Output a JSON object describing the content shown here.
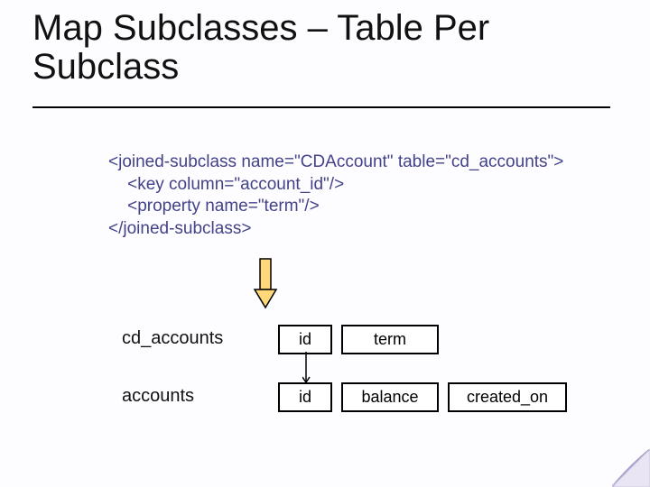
{
  "title": "Map Subclasses – Table Per Subclass",
  "code": {
    "l1": "<joined-subclass name=\"CDAccount\" table=\"cd_accounts\">",
    "l2": "    <key column=\"account_id\"/>",
    "l3": "    <property name=\"term\"/>",
    "l4": "</joined-subclass>"
  },
  "labels": {
    "cd_accounts": "cd_accounts",
    "accounts": "accounts"
  },
  "cells": {
    "id": "id",
    "term": "term",
    "balance": "balance",
    "created_on": "created_on"
  }
}
